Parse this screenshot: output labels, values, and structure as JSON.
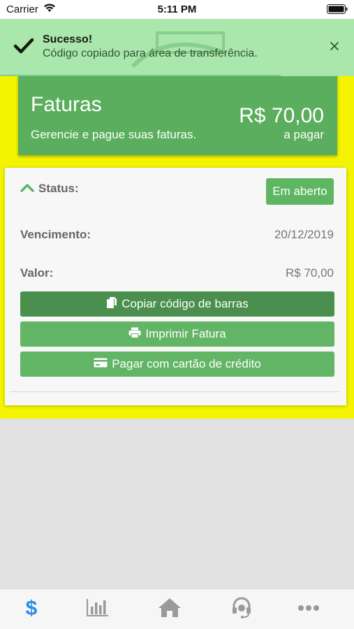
{
  "statusbar": {
    "carrier": "Carrier",
    "time": "5:11 PM"
  },
  "toast": {
    "title": "Sucesso!",
    "message": "Código copiado para área de transferência.",
    "close": "×"
  },
  "header": {
    "title": "Faturas",
    "subtitle": "Gerencie e pague suas faturas.",
    "amount": "R$ 70,00",
    "amount_label": "a pagar"
  },
  "invoice": {
    "status_label": "Status:",
    "status_value": "Em aberto",
    "due_label": "Vencimento:",
    "due_value": "20/12/2019",
    "value_label": "Valor:",
    "value_value": "R$ 70,00"
  },
  "buttons": {
    "copy": "Copiar código de barras",
    "print": "Imprimir Fatura",
    "pay_card": "Pagar com cartão de crédito"
  },
  "tabbar": {
    "items": [
      {
        "icon": "dollar-icon",
        "label": "$"
      },
      {
        "icon": "chart-bars-icon"
      },
      {
        "icon": "home-icon"
      },
      {
        "icon": "headset-icon"
      },
      {
        "icon": "more-icon"
      }
    ],
    "active_color": "#2c8ee3",
    "inactive_color": "#9a9a9a"
  },
  "colors": {
    "primary": "#5aae5d",
    "button_dark": "#4a8f4d",
    "toast_bg": "#a8e7b2",
    "highlight_bg": "#f4f400"
  }
}
